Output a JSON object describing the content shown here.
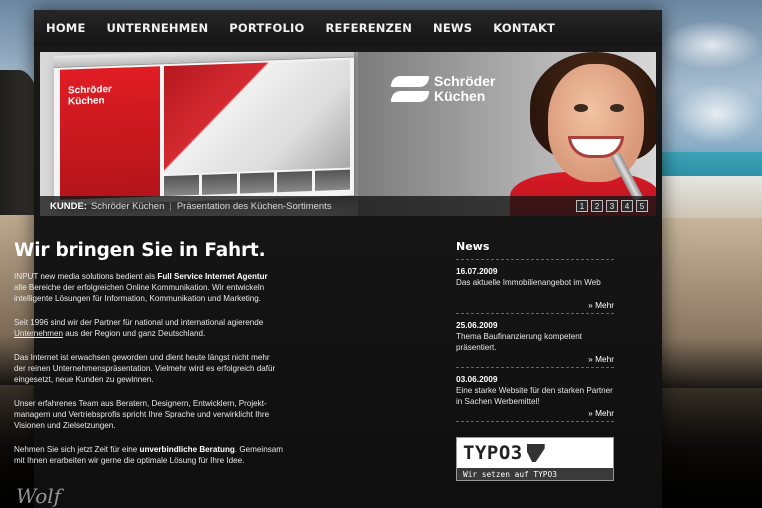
{
  "nav": {
    "items": [
      {
        "label": "HOME"
      },
      {
        "label": "UNTERNEHMEN"
      },
      {
        "label": "PORTFOLIO"
      },
      {
        "label": "REFERENZEN"
      },
      {
        "label": "NEWS"
      },
      {
        "label": "KONTAKT"
      }
    ]
  },
  "banner": {
    "brand_line1": "Schröder",
    "brand_line2": "Küchen",
    "shot_brand_line1": "Schröder",
    "shot_brand_line2": "Küchen",
    "caption_label": "KUNDE:",
    "caption_client": "Schröder Küchen",
    "caption_separator": "|",
    "caption_desc": "Präsentation des Küchen-Sortiments",
    "pages": [
      "1",
      "2",
      "3",
      "4",
      "5"
    ]
  },
  "content": {
    "headline": "Wir bringen Sie in Fahrt.",
    "p1_a": "INPUT new media solutions bedient als ",
    "p1_b": "Full Service Internet Agentur",
    "p1_c": "alle Bereiche der erfolgreichen Online Kommunikation. Wir entwickeln",
    "p1_d": "intelligente Lösungen für Information, Kommunikation und Marketing.",
    "p2_a": "Seit 1996 sind wir der Partner für national und international agierende",
    "p2_link": "Unternehmen",
    "p2_b": " aus der Region und ganz Deutschland.",
    "p3_a": "Das Internet ist erwachsen geworden und dient heute längst nicht mehr",
    "p3_b": "der reinen Unternehmenspräsentation. Vielmehr wird es erfolgreich dafür",
    "p3_c": "eingesetzt, neue Kunden zu gewinnen.",
    "p4_a": "Unser erfahrenes Team aus Beratern, Designern, Entwicklern, Projekt-",
    "p4_b": "managern und Vertriebsprofis spricht Ihre Sprache und verwirklicht Ihre",
    "p4_c": "Visionen und  Zielsetzungen.",
    "p5_a": "Nehmen Sie sich jetzt Zeit für eine ",
    "p5_b": "unverbindliche Beratung",
    "p5_c": ". Gemeinsam",
    "p5_d": "mit Ihnen erarbeiten wir gerne die optimale Lösung für Ihre Idee.",
    "signature": "Wolf"
  },
  "news": {
    "title": "News",
    "more_label": "» Mehr",
    "items": [
      {
        "date": "16.07.2009",
        "text": "Das aktuelle Immobilienangebot im Web"
      },
      {
        "date": "25.06.2009",
        "text": "Thema Baufinanzierung kompetent präsentiert."
      },
      {
        "date": "03.06.2009",
        "text": "Eine starke Website für den starken Partner in Sachen Werbemittel!"
      }
    ]
  },
  "typo3": {
    "logo": "TYPO3",
    "tagline": "Wir setzen auf TYPO3"
  }
}
